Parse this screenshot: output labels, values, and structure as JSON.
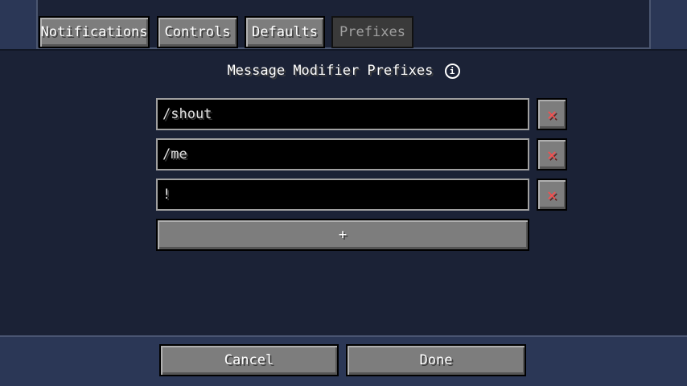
{
  "tabs": [
    {
      "label": "Notifications",
      "active": false
    },
    {
      "label": "Controls",
      "active": false
    },
    {
      "label": "Defaults",
      "active": false
    },
    {
      "label": "Prefixes",
      "active": true
    }
  ],
  "section": {
    "title": "Message Modifier Prefixes",
    "info_icon": "info-icon"
  },
  "prefixes": [
    {
      "value": "/shout",
      "remove_icon": "close-icon"
    },
    {
      "value": "/me",
      "remove_icon": "close-icon"
    },
    {
      "value": "!",
      "remove_icon": "close-icon"
    }
  ],
  "add_button": {
    "label": "+"
  },
  "footer": {
    "cancel_label": "Cancel",
    "done_label": "Done"
  },
  "colors": {
    "background": "#2b3756",
    "panel": "#1b2236",
    "remove_icon": "#ff4c4c"
  }
}
